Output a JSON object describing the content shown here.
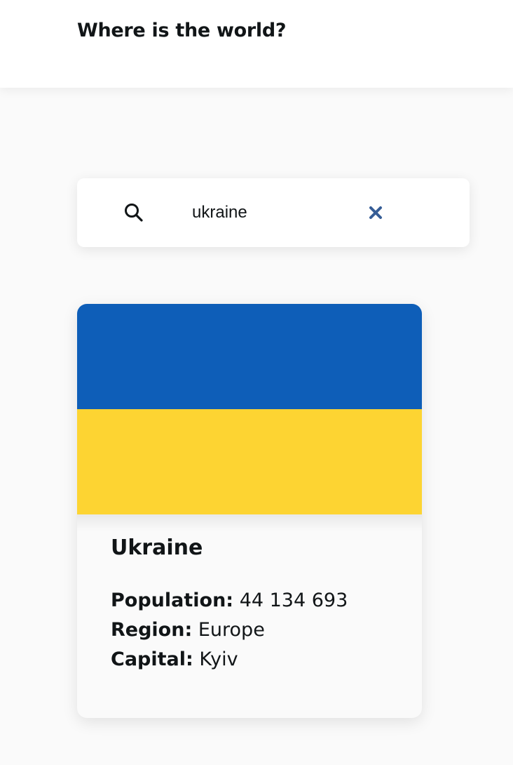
{
  "header": {
    "title": "Where is the world?"
  },
  "search": {
    "value": "ukraine",
    "icon": "search-icon",
    "clear_icon": "close-icon"
  },
  "colors": {
    "flag_blue": "#0e5eb8",
    "flag_yellow": "#fdd432",
    "clear_icon": "#365d96"
  },
  "countries": [
    {
      "name": "Ukraine",
      "flag": "ukraine-flag",
      "population_label": "Population:",
      "population": "44 134 693",
      "region_label": "Region:",
      "region": "Europe",
      "capital_label": "Capital:",
      "capital": "Kyiv"
    }
  ]
}
